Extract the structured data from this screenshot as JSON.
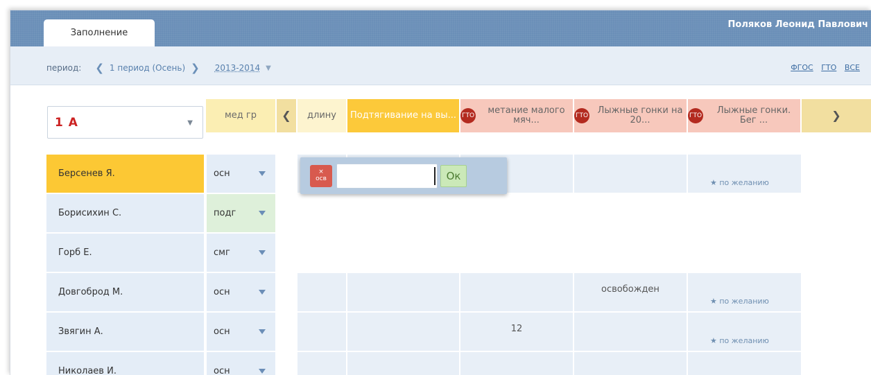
{
  "header": {
    "tab_label": "Заполнение",
    "user_name": "Поляков Леонид Павлович"
  },
  "toolbar": {
    "period_label": "период:",
    "period_value": "1 период (Осень)",
    "year_value": "2013-2014",
    "links": [
      "ФГОС",
      "ГТО",
      "ВСЕ"
    ]
  },
  "class_select": {
    "value": "1 А"
  },
  "columns": {
    "med_group": "мед гр",
    "prev_partial": "длину",
    "c1": "Подтягивание на вы...",
    "c2": "метание малого мяч...",
    "c3": "Лыжные гонки на 20...",
    "c4": "Лыжные гонки. Бег ...",
    "gto_badge": "ГТО"
  },
  "students": [
    {
      "name": "Берсенев Я.",
      "group": "осн"
    },
    {
      "name": "Борисихин С.",
      "group": "подг"
    },
    {
      "name": "Горб Е.",
      "group": "смг"
    },
    {
      "name": "Довгоброд М.",
      "group": "осн"
    },
    {
      "name": "Звягин А.",
      "group": "осн"
    },
    {
      "name": "Николаев И.",
      "group": "осн"
    }
  ],
  "cells": {
    "dovgobrod_c3": "освобожден",
    "zvyagin_c2": "12",
    "optional": "★ по желанию"
  },
  "editor": {
    "exempt_button": "× осв",
    "ok_button": "Ок",
    "input_value": ""
  },
  "colors": {
    "topbar": "#6a8fb8",
    "active_row": "#fcc834",
    "gto_badge": "#b32a1f"
  }
}
